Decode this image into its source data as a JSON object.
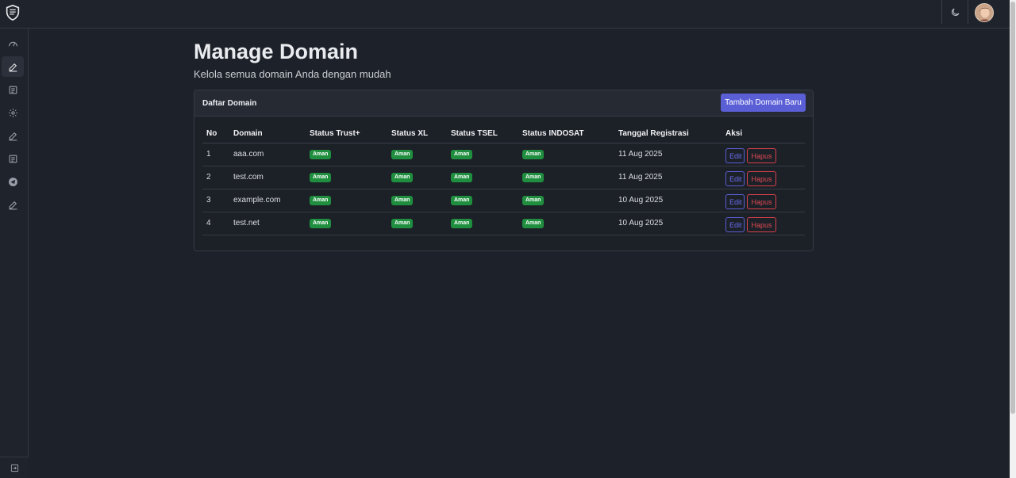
{
  "header": {
    "logo_icon": "shield-icon",
    "theme_icon": "moon-icon",
    "avatar_icon": "user-avatar"
  },
  "sidebar": {
    "items": [
      {
        "icon": "speedometer-icon",
        "active": false
      },
      {
        "icon": "pen-icon",
        "active": true
      },
      {
        "icon": "document-icon",
        "active": false
      },
      {
        "icon": "gear-icon",
        "active": false
      },
      {
        "icon": "pen-icon",
        "active": false
      },
      {
        "icon": "document-icon",
        "active": false
      },
      {
        "icon": "telegram-icon",
        "active": false
      },
      {
        "icon": "pen-icon",
        "active": false
      }
    ],
    "collapse_icon": "collapse-icon"
  },
  "main": {
    "title": "Manage Domain",
    "subtitle": "Kelola semua domain Anda dengan mudah"
  },
  "card": {
    "title": "Daftar Domain",
    "add_button": "Tambah Domain Baru",
    "columns": [
      "No",
      "Domain",
      "Status Trust+",
      "Status XL",
      "Status TSEL",
      "Status INDOSAT",
      "Tanggal Registrasi",
      "Aksi"
    ],
    "rows": [
      {
        "no": "1",
        "domain": "aaa.com",
        "trust": "Aman",
        "xl": "Aman",
        "tsel": "Aman",
        "indosat": "Aman",
        "date": "11 Aug 2025",
        "edit": "Edit",
        "hapus": "Hapus"
      },
      {
        "no": "2",
        "domain": "test.com",
        "trust": "Aman",
        "xl": "Aman",
        "tsel": "Aman",
        "indosat": "Aman",
        "date": "11 Aug 2025",
        "edit": "Edit",
        "hapus": "Hapus"
      },
      {
        "no": "3",
        "domain": "example.com",
        "trust": "Aman",
        "xl": "Aman",
        "tsel": "Aman",
        "indosat": "Aman",
        "date": "10 Aug 2025",
        "edit": "Edit",
        "hapus": "Hapus"
      },
      {
        "no": "4",
        "domain": "test.net",
        "trust": "Aman",
        "xl": "Aman",
        "tsel": "Aman",
        "indosat": "Aman",
        "date": "10 Aug 2025",
        "edit": "Edit",
        "hapus": "Hapus"
      }
    ]
  },
  "colors": {
    "accent": "#5b5fd6",
    "danger": "#d8414c",
    "success": "#1f8f3f",
    "background": "#1d2129"
  }
}
